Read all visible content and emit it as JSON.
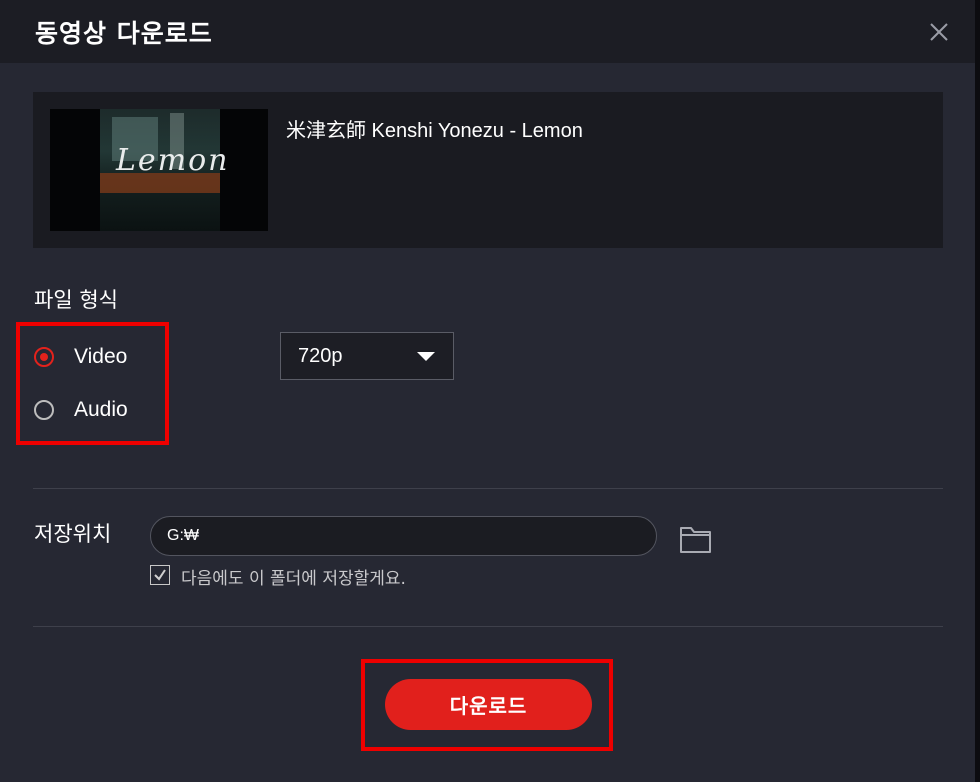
{
  "window": {
    "title": "동영상 다운로드",
    "close_icon": "close-icon"
  },
  "video": {
    "thumbnail_text": "Lemon",
    "title": "米津玄師  Kenshi Yonezu  - Lemon"
  },
  "format": {
    "label": "파일 형식",
    "options": [
      {
        "label": "Video",
        "selected": true
      },
      {
        "label": "Audio",
        "selected": false
      }
    ],
    "quality": "720p"
  },
  "save": {
    "label": "저장위치",
    "path": "G:₩",
    "folder_icon": "folder-icon",
    "remember_label": "다음에도 이 폴더에 저장할게요.",
    "remember_checked": true
  },
  "actions": {
    "download_label": "다운로드"
  },
  "colors": {
    "accent": "#e1201c",
    "highlight_box": "#ee0000",
    "background": "#262833",
    "titlebar": "#1c1d24"
  }
}
